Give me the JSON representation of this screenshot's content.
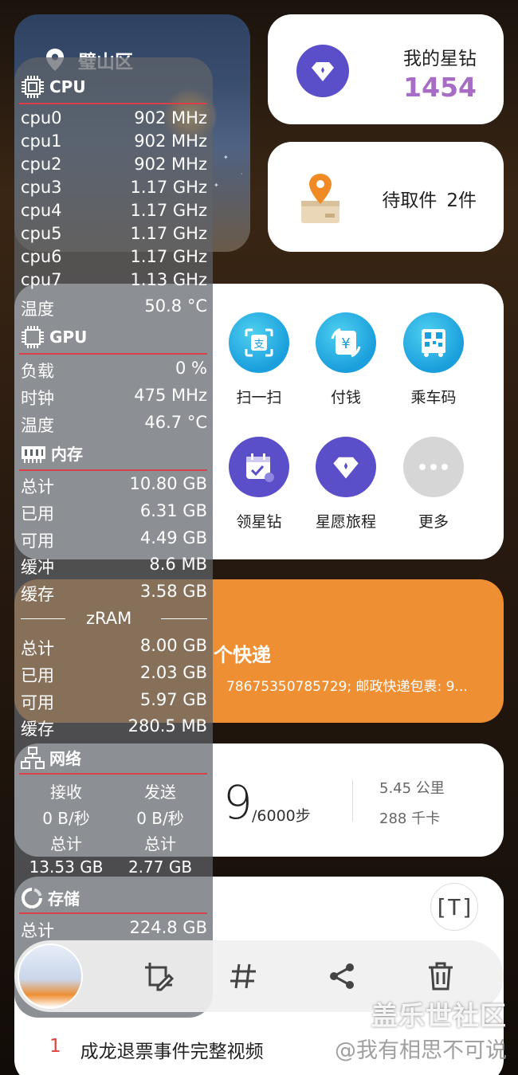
{
  "weather": {
    "location": "璧山区"
  },
  "points_card": {
    "title": "我的星钻",
    "value": "1454"
  },
  "pickup_card": {
    "label": "待取件",
    "count": "2件"
  },
  "quick_actions": [
    {
      "label": "扫一扫",
      "icon": "scan-icon"
    },
    {
      "label": "付钱",
      "icon": "pay-icon"
    },
    {
      "label": "乘车码",
      "icon": "bus-code-icon"
    },
    {
      "label": "领星钻",
      "icon": "calendar-gift-icon"
    },
    {
      "label": "星愿旅程",
      "icon": "diamond-icon"
    },
    {
      "label": "更多",
      "icon": "more-icon"
    }
  ],
  "express_card": {
    "title": "个快递",
    "subtitle": "78675350785729; 邮政快递包裹: 9..."
  },
  "steps_card": {
    "steps_partial": "9",
    "goal": "/6000步",
    "distance": "5.45 公里",
    "calories": "288 千卡"
  },
  "news": {
    "rank": "1",
    "headline": "成龙退票事件完整视频"
  },
  "monitor": {
    "cpu": {
      "title": "CPU",
      "cores": [
        {
          "name": "cpu0",
          "freq": "902 MHz"
        },
        {
          "name": "cpu1",
          "freq": "902 MHz"
        },
        {
          "name": "cpu2",
          "freq": "902 MHz"
        },
        {
          "name": "cpu3",
          "freq": "1.17 GHz"
        },
        {
          "name": "cpu4",
          "freq": "1.17 GHz"
        },
        {
          "name": "cpu5",
          "freq": "1.17 GHz"
        },
        {
          "name": "cpu6",
          "freq": "1.17 GHz"
        },
        {
          "name": "cpu7",
          "freq": "1.13 GHz"
        }
      ],
      "temp_label": "温度",
      "temp": "50.8 °C"
    },
    "gpu": {
      "title": "GPU",
      "load_label": "负载",
      "load": "0 %",
      "clock_label": "时钟",
      "clock": "475 MHz",
      "temp_label": "温度",
      "temp": "46.7 °C"
    },
    "memory": {
      "title": "内存",
      "rows": [
        {
          "label": "总计",
          "value": "10.80 GB"
        },
        {
          "label": "已用",
          "value": "6.31 GB"
        },
        {
          "label": "可用",
          "value": "4.49 GB"
        },
        {
          "label": "缓冲",
          "value": "8.6 MB"
        },
        {
          "label": "缓存",
          "value": "3.58 GB"
        }
      ],
      "zram_title": "zRAM",
      "zram_rows": [
        {
          "label": "总计",
          "value": "8.00 GB"
        },
        {
          "label": "已用",
          "value": "2.03 GB"
        },
        {
          "label": "可用",
          "value": "5.97 GB"
        },
        {
          "label": "缓存",
          "value": "280.5 MB"
        }
      ]
    },
    "network": {
      "title": "网络",
      "recv_label": "接收",
      "send_label": "发送",
      "recv_rate": "0 B/秒",
      "send_rate": "0 B/秒",
      "recv_total_label": "总计",
      "send_total_label": "总计",
      "recv_total": "13.53 GB",
      "send_total": "2.77 GB"
    },
    "storage": {
      "title": "存储",
      "total_label": "总计",
      "total": "224.8 GB"
    }
  },
  "toolbar": {
    "icons": [
      "edit-crop-icon",
      "hashtag-icon",
      "share-icon",
      "delete-icon"
    ]
  },
  "watermarks": {
    "brand": "盖乐世社区",
    "author": "@我有相思不可说"
  },
  "colors": {
    "accent_red": "#d8414a",
    "purple": "#5a4fc8",
    "orange": "#ee8f33",
    "points_purple": "#a76cc4"
  }
}
